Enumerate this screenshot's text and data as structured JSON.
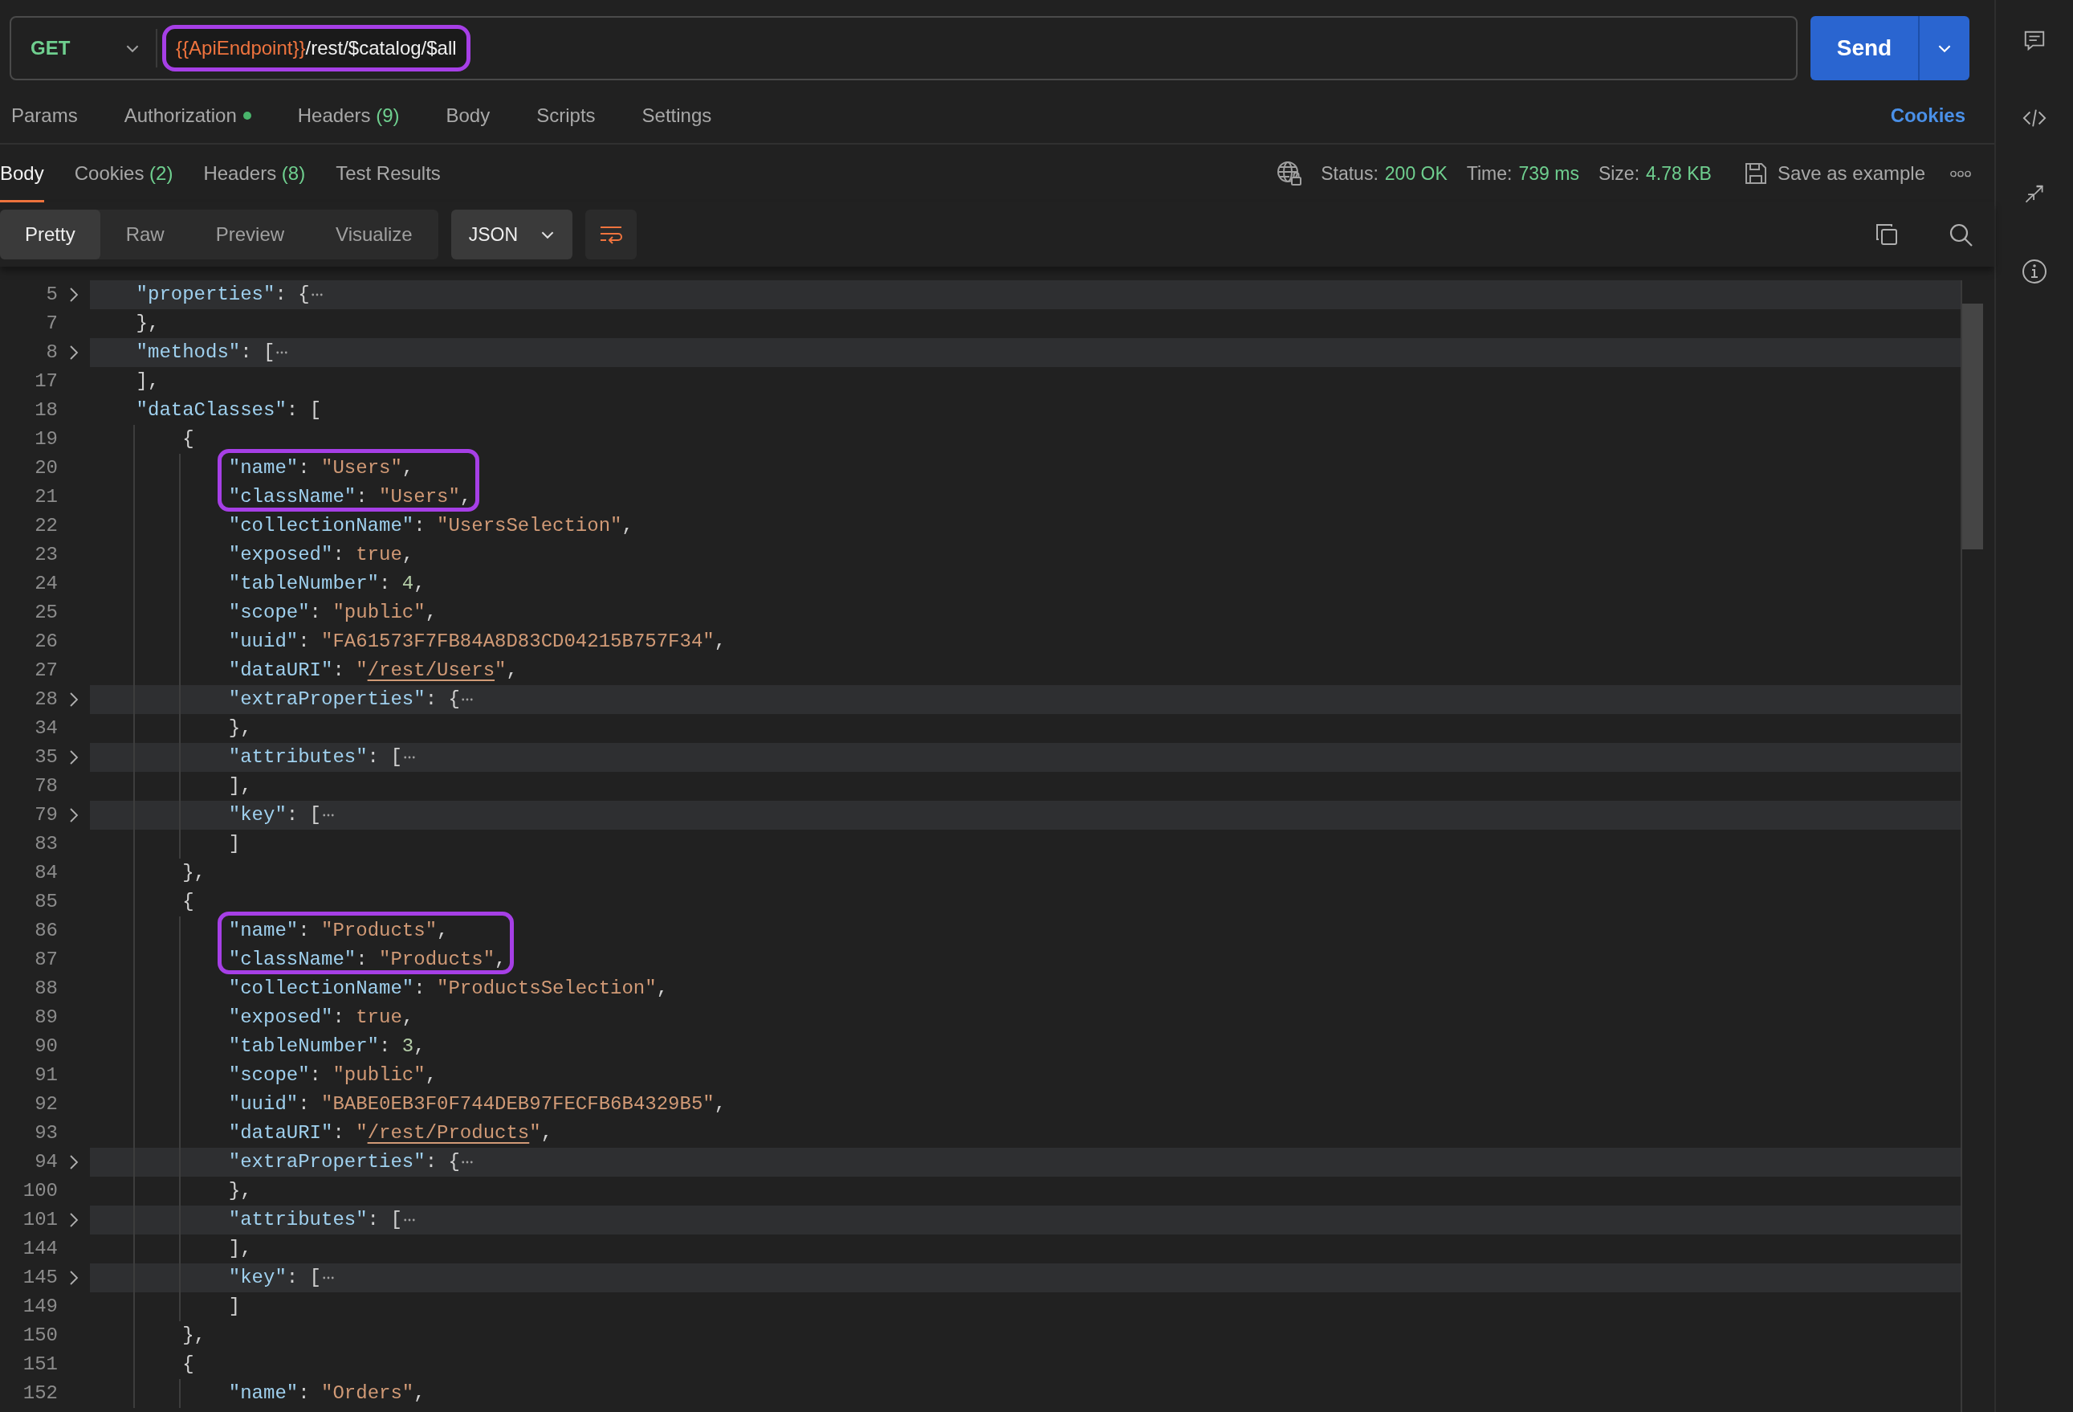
{
  "request": {
    "method": "GET",
    "url_variable": "{{ApiEndpoint}}",
    "url_path": "/rest/$catalog/$all",
    "url_highlighted": true,
    "send": "Send"
  },
  "request_tabs": [
    {
      "label": "Params",
      "selected": false
    },
    {
      "label": "Authorization",
      "indicator": true,
      "selected": false
    },
    {
      "label": "Headers",
      "count": "(9)",
      "selected": false
    },
    {
      "label": "Body",
      "selected": false
    },
    {
      "label": "Scripts",
      "selected": false
    },
    {
      "label": "Settings",
      "selected": false
    }
  ],
  "cookies_link": "Cookies",
  "response_tabs": [
    {
      "label": "Body",
      "selected": true
    },
    {
      "label": "Cookies",
      "count": "(2)",
      "selected": false
    },
    {
      "label": "Headers",
      "count": "(8)",
      "selected": false
    },
    {
      "label": "Test Results",
      "selected": false
    }
  ],
  "response_meta": [
    {
      "label": "Status:",
      "value": "200 OK"
    },
    {
      "label": "Time:",
      "value": "739 ms"
    },
    {
      "label": "Size:",
      "value": "4.78 KB"
    }
  ],
  "save_example": "Save as example",
  "view_modes": [
    {
      "label": "Pretty",
      "selected": true
    },
    {
      "label": "Raw",
      "selected": false
    },
    {
      "label": "Preview",
      "selected": false
    },
    {
      "label": "Visualize",
      "selected": false
    }
  ],
  "format": "JSON",
  "lines": [
    {
      "number": "5",
      "collapsed": true,
      "highlighted": false,
      "tokens": [
        {
          "kind": "key",
          "text": "    \"properties\""
        },
        {
          "kind": "punct",
          "text": ": {"
        }
      ]
    },
    {
      "number": "7",
      "collapsed": false,
      "highlighted": false,
      "tokens": [
        {
          "kind": "punct",
          "text": "    },"
        }
      ]
    },
    {
      "number": "8",
      "collapsed": true,
      "highlighted": false,
      "tokens": [
        {
          "kind": "key",
          "text": "    \"methods\""
        },
        {
          "kind": "punct",
          "text": ": ["
        }
      ]
    },
    {
      "number": "17",
      "collapsed": false,
      "highlighted": false,
      "tokens": [
        {
          "kind": "punct",
          "text": "    ],"
        }
      ]
    },
    {
      "number": "18",
      "collapsed": false,
      "highlighted": false,
      "tokens": [
        {
          "kind": "key",
          "text": "    \"dataClasses\""
        },
        {
          "kind": "punct",
          "text": ": ["
        }
      ]
    },
    {
      "number": "19",
      "collapsed": false,
      "highlighted": false,
      "tokens": [
        {
          "kind": "punct",
          "text": "        {"
        }
      ]
    },
    {
      "number": "20",
      "collapsed": false,
      "highlighted": true,
      "tokens": [
        {
          "kind": "key",
          "text": "            \"name\""
        },
        {
          "kind": "punct",
          "text": ": "
        },
        {
          "kind": "string",
          "text": "\"Users\""
        },
        {
          "kind": "punct",
          "text": ","
        }
      ]
    },
    {
      "number": "21",
      "collapsed": false,
      "highlighted": true,
      "tokens": [
        {
          "kind": "key",
          "text": "            \"className\""
        },
        {
          "kind": "punct",
          "text": ": "
        },
        {
          "kind": "string",
          "text": "\"Users\""
        },
        {
          "kind": "punct",
          "text": ","
        }
      ]
    },
    {
      "number": "22",
      "collapsed": false,
      "highlighted": false,
      "tokens": [
        {
          "kind": "key",
          "text": "            \"collectionName\""
        },
        {
          "kind": "punct",
          "text": ": "
        },
        {
          "kind": "string",
          "text": "\"UsersSelection\""
        },
        {
          "kind": "punct",
          "text": ","
        }
      ]
    },
    {
      "number": "23",
      "collapsed": false,
      "highlighted": false,
      "tokens": [
        {
          "kind": "key",
          "text": "            \"exposed\""
        },
        {
          "kind": "punct",
          "text": ": "
        },
        {
          "kind": "bool",
          "text": "true"
        },
        {
          "kind": "punct",
          "text": ","
        }
      ]
    },
    {
      "number": "24",
      "collapsed": false,
      "highlighted": false,
      "tokens": [
        {
          "kind": "key",
          "text": "            \"tableNumber\""
        },
        {
          "kind": "punct",
          "text": ": "
        },
        {
          "kind": "number",
          "text": "4"
        },
        {
          "kind": "punct",
          "text": ","
        }
      ]
    },
    {
      "number": "25",
      "collapsed": false,
      "highlighted": false,
      "tokens": [
        {
          "kind": "key",
          "text": "            \"scope\""
        },
        {
          "kind": "punct",
          "text": ": "
        },
        {
          "kind": "string",
          "text": "\"public\""
        },
        {
          "kind": "punct",
          "text": ","
        }
      ]
    },
    {
      "number": "26",
      "collapsed": false,
      "highlighted": false,
      "tokens": [
        {
          "kind": "key",
          "text": "            \"uuid\""
        },
        {
          "kind": "punct",
          "text": ": "
        },
        {
          "kind": "string",
          "text": "\"FA61573F7FB84A8D83CD04215B757F34\""
        },
        {
          "kind": "punct",
          "text": ","
        }
      ]
    },
    {
      "number": "27",
      "collapsed": false,
      "highlighted": false,
      "tokens": [
        {
          "kind": "key",
          "text": "            \"dataURI\""
        },
        {
          "kind": "punct",
          "text": ": "
        },
        {
          "kind": "string",
          "text": "\""
        },
        {
          "kind": "link",
          "text": "/rest/Users"
        },
        {
          "kind": "string",
          "text": "\""
        },
        {
          "kind": "punct",
          "text": ","
        }
      ]
    },
    {
      "number": "28",
      "collapsed": true,
      "highlighted": false,
      "tokens": [
        {
          "kind": "key",
          "text": "            \"extraProperties\""
        },
        {
          "kind": "punct",
          "text": ": {"
        }
      ]
    },
    {
      "number": "34",
      "collapsed": false,
      "highlighted": false,
      "tokens": [
        {
          "kind": "punct",
          "text": "            },"
        }
      ]
    },
    {
      "number": "35",
      "collapsed": true,
      "highlighted": false,
      "tokens": [
        {
          "kind": "key",
          "text": "            \"attributes\""
        },
        {
          "kind": "punct",
          "text": ": ["
        }
      ]
    },
    {
      "number": "78",
      "collapsed": false,
      "highlighted": false,
      "tokens": [
        {
          "kind": "punct",
          "text": "            ],"
        }
      ]
    },
    {
      "number": "79",
      "collapsed": true,
      "highlighted": false,
      "tokens": [
        {
          "kind": "key",
          "text": "            \"key\""
        },
        {
          "kind": "punct",
          "text": ": ["
        }
      ]
    },
    {
      "number": "83",
      "collapsed": false,
      "highlighted": false,
      "tokens": [
        {
          "kind": "punct",
          "text": "            ]"
        }
      ]
    },
    {
      "number": "84",
      "collapsed": false,
      "highlighted": false,
      "tokens": [
        {
          "kind": "punct",
          "text": "        },"
        }
      ]
    },
    {
      "number": "85",
      "collapsed": false,
      "highlighted": false,
      "tokens": [
        {
          "kind": "punct",
          "text": "        {"
        }
      ]
    },
    {
      "number": "86",
      "collapsed": false,
      "highlighted": true,
      "tokens": [
        {
          "kind": "key",
          "text": "            \"name\""
        },
        {
          "kind": "punct",
          "text": ": "
        },
        {
          "kind": "string",
          "text": "\"Products\""
        },
        {
          "kind": "punct",
          "text": ","
        }
      ]
    },
    {
      "number": "87",
      "collapsed": false,
      "highlighted": true,
      "tokens": [
        {
          "kind": "key",
          "text": "            \"className\""
        },
        {
          "kind": "punct",
          "text": ": "
        },
        {
          "kind": "string",
          "text": "\"Products\""
        },
        {
          "kind": "punct",
          "text": ","
        }
      ]
    },
    {
      "number": "88",
      "collapsed": false,
      "highlighted": false,
      "tokens": [
        {
          "kind": "key",
          "text": "            \"collectionName\""
        },
        {
          "kind": "punct",
          "text": ": "
        },
        {
          "kind": "string",
          "text": "\"ProductsSelection\""
        },
        {
          "kind": "punct",
          "text": ","
        }
      ]
    },
    {
      "number": "89",
      "collapsed": false,
      "highlighted": false,
      "tokens": [
        {
          "kind": "key",
          "text": "            \"exposed\""
        },
        {
          "kind": "punct",
          "text": ": "
        },
        {
          "kind": "bool",
          "text": "true"
        },
        {
          "kind": "punct",
          "text": ","
        }
      ]
    },
    {
      "number": "90",
      "collapsed": false,
      "highlighted": false,
      "tokens": [
        {
          "kind": "key",
          "text": "            \"tableNumber\""
        },
        {
          "kind": "punct",
          "text": ": "
        },
        {
          "kind": "number",
          "text": "3"
        },
        {
          "kind": "punct",
          "text": ","
        }
      ]
    },
    {
      "number": "91",
      "collapsed": false,
      "highlighted": false,
      "tokens": [
        {
          "kind": "key",
          "text": "            \"scope\""
        },
        {
          "kind": "punct",
          "text": ": "
        },
        {
          "kind": "string",
          "text": "\"public\""
        },
        {
          "kind": "punct",
          "text": ","
        }
      ]
    },
    {
      "number": "92",
      "collapsed": false,
      "highlighted": false,
      "tokens": [
        {
          "kind": "key",
          "text": "            \"uuid\""
        },
        {
          "kind": "punct",
          "text": ": "
        },
        {
          "kind": "string",
          "text": "\"BABE0EB3F0F744DEB97FECFB6B4329B5\""
        },
        {
          "kind": "punct",
          "text": ","
        }
      ]
    },
    {
      "number": "93",
      "collapsed": false,
      "highlighted": false,
      "tokens": [
        {
          "kind": "key",
          "text": "            \"dataURI\""
        },
        {
          "kind": "punct",
          "text": ": "
        },
        {
          "kind": "string",
          "text": "\""
        },
        {
          "kind": "link",
          "text": "/rest/Products"
        },
        {
          "kind": "string",
          "text": "\""
        },
        {
          "kind": "punct",
          "text": ","
        }
      ]
    },
    {
      "number": "94",
      "collapsed": true,
      "highlighted": false,
      "tokens": [
        {
          "kind": "key",
          "text": "            \"extraProperties\""
        },
        {
          "kind": "punct",
          "text": ": {"
        }
      ]
    },
    {
      "number": "100",
      "collapsed": false,
      "highlighted": false,
      "tokens": [
        {
          "kind": "punct",
          "text": "            },"
        }
      ]
    },
    {
      "number": "101",
      "collapsed": true,
      "highlighted": false,
      "tokens": [
        {
          "kind": "key",
          "text": "            \"attributes\""
        },
        {
          "kind": "punct",
          "text": ": ["
        }
      ]
    },
    {
      "number": "144",
      "collapsed": false,
      "highlighted": false,
      "tokens": [
        {
          "kind": "punct",
          "text": "            ],"
        }
      ]
    },
    {
      "number": "145",
      "collapsed": true,
      "highlighted": false,
      "tokens": [
        {
          "kind": "key",
          "text": "            \"key\""
        },
        {
          "kind": "punct",
          "text": ": ["
        }
      ]
    },
    {
      "number": "149",
      "collapsed": false,
      "highlighted": false,
      "tokens": [
        {
          "kind": "punct",
          "text": "            ]"
        }
      ]
    },
    {
      "number": "150",
      "collapsed": false,
      "highlighted": false,
      "tokens": [
        {
          "kind": "punct",
          "text": "        },"
        }
      ]
    },
    {
      "number": "151",
      "collapsed": false,
      "highlighted": false,
      "tokens": [
        {
          "kind": "punct",
          "text": "        {"
        }
      ]
    },
    {
      "number": "152",
      "collapsed": false,
      "highlighted": false,
      "tokens": [
        {
          "kind": "key",
          "text": "            \"name\""
        },
        {
          "kind": "punct",
          "text": ": "
        },
        {
          "kind": "string",
          "text": "\"Orders\""
        },
        {
          "kind": "punct",
          "text": ","
        }
      ]
    }
  ]
}
